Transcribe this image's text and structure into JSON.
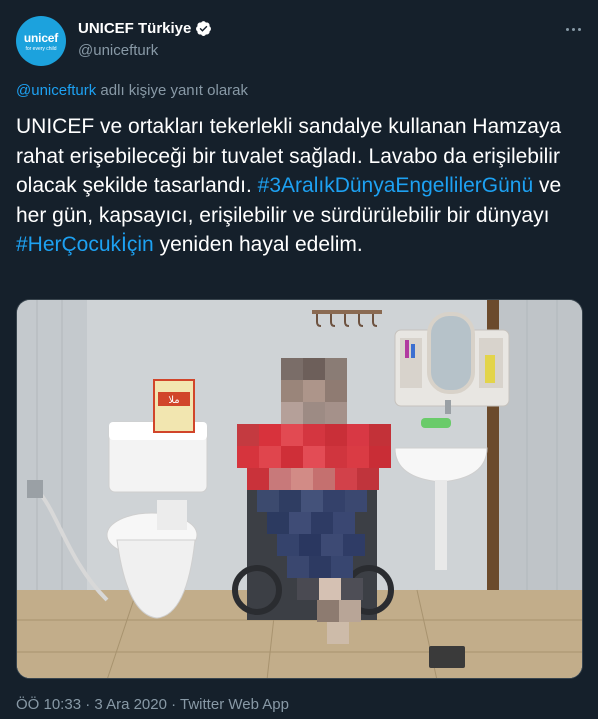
{
  "account": {
    "avatar_text": "unicef",
    "avatar_tagline": "for every child",
    "display_name": "UNICEF Türkiye",
    "handle": "@unicefturk"
  },
  "reply": {
    "mention": "@unicefturk",
    "suffix": " adlı kişiye yanıt olarak"
  },
  "tweet": {
    "line1": "UNICEF ve ortakları tekerlekli sandalye kullanan Hamzaya rahat erişebileceği bir tuvalet sağladı. Lavabo da erişilebilir olacak şekilde tasarlandı.",
    "hashtag1": "#3AralıkDünyaEngellilerGünü",
    "mid": " ve her gün, kapsayıcı, erişilebilir ve sürdürülebilir bir dünyayı ",
    "hashtag2": "#HerÇocukİçin",
    "end": " yeniden hayal edelim."
  },
  "photo": {
    "sign_text": "ملا"
  },
  "meta": {
    "time": "ÖÖ 10:33",
    "sep1": " · ",
    "date": "3 Ara 2020",
    "sep2": " · ",
    "source": "Twitter Web App"
  },
  "colors": {
    "background": "#15202b",
    "accent": "#1da1f2",
    "muted": "#8899a6",
    "unicef_blue": "#1ca2dd"
  }
}
